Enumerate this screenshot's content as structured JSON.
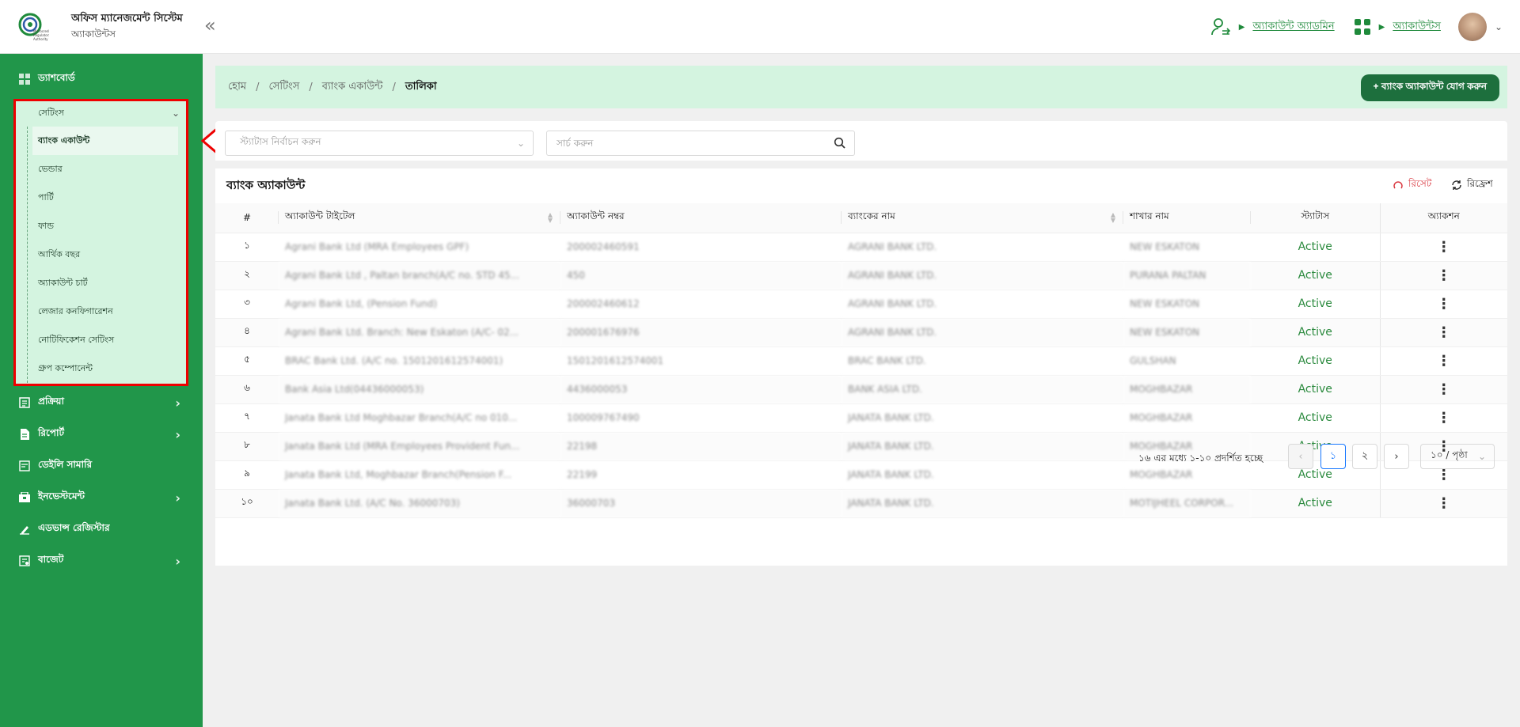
{
  "header": {
    "app_name": "অফিস ম্যানেজমেন্ট সিস্টেম",
    "app_sub": "অ্যাকাউন্টস",
    "role_link": "অ্যাকাউন্ট অ্যাডমিন",
    "module_link": "অ্যাকাউন্টস",
    "logo_text": [
      "Microcredit",
      "Regulatory",
      "Authority"
    ]
  },
  "sidebar": {
    "dashboard": "ড্যাশবোর্ড",
    "settings": "সেটিংস",
    "settings_items": [
      "ব্যাংক একাউন্ট",
      "ভেন্ডার",
      "পার্টি",
      "ফান্ড",
      "আর্থিক বছর",
      "অ্যাকাউন্ট চার্ট",
      "লেজার কনফিগারেশন",
      "নোটিফিকেশন সেটিংস",
      "গ্রুপ কম্পোনেন্ট"
    ],
    "process": "প্রক্রিয়া",
    "report": "রিপোর্ট",
    "daily_summary": "ডেইলি সামারি",
    "investment": "ইনভেস্টমেন্ট",
    "advance_register": "এডভান্স রেজিস্টার",
    "budget": "বাজেট"
  },
  "breadcrumb": [
    "হোম",
    "সেটিংস",
    "ব্যাংক একাউন্ট",
    "তালিকা"
  ],
  "add_button": "+ ব্যাংক অ্যাকাউন্ট যোগ করুন",
  "filters": {
    "status_placeholder": "স্ট্যাটাস নির্বাচন করুন",
    "search_placeholder": "সার্চ করুন"
  },
  "panel": {
    "title": "ব্যাংক অ্যাকাউন্ট",
    "reset": "রিসেট",
    "refresh": "রিফ্রেশ"
  },
  "table": {
    "headers": [
      "#",
      "অ্যাকাউন্ট টাইটেল",
      "অ্যাকাউন্ট নম্বর",
      "ব্যাংকের নাম",
      "শাখার নাম",
      "স্ট্যাটাস",
      "অ্যাকশন"
    ],
    "rows": [
      {
        "n": "১",
        "title": "Agrani Bank Ltd (MRA Employees GPF)",
        "acc": "200002460591",
        "bank": "AGRANI BANK LTD.",
        "branch": "NEW ESKATON",
        "status": "Active"
      },
      {
        "n": "২",
        "title": "Agrani Bank Ltd , Paltan branch(A/C no. STD 45...",
        "acc": "450",
        "bank": "AGRANI BANK LTD.",
        "branch": "PURANA PALTAN",
        "status": "Active"
      },
      {
        "n": "৩",
        "title": "Agrani Bank Ltd, (Pension Fund)",
        "acc": "200002460612",
        "bank": "AGRANI BANK LTD.",
        "branch": "NEW ESKATON",
        "status": "Active"
      },
      {
        "n": "৪",
        "title": "Agrani Bank Ltd. Branch: New Eskaton (A/C- 02...",
        "acc": "200001676976",
        "bank": "AGRANI BANK LTD.",
        "branch": "NEW ESKATON",
        "status": "Active"
      },
      {
        "n": "৫",
        "title": "BRAC Bank Ltd. (A/C no. 1501201612574001)",
        "acc": "1501201612574001",
        "bank": "BRAC BANK LTD.",
        "branch": "GULSHAN",
        "status": "Active"
      },
      {
        "n": "৬",
        "title": "Bank Asia Ltd(04436000053)",
        "acc": "4436000053",
        "bank": "BANK ASIA LTD.",
        "branch": "MOGHBAZAR",
        "status": "Active"
      },
      {
        "n": "৭",
        "title": "Janata Bank Ltd Moghbazar Branch(A/C no 010...",
        "acc": "100009767490",
        "bank": "JANATA BANK LTD.",
        "branch": "MOGHBAZAR",
        "status": "Active"
      },
      {
        "n": "৮",
        "title": "Janata Bank Ltd (MRA Employees Provident Fun...",
        "acc": "22198",
        "bank": "JANATA BANK LTD.",
        "branch": "MOGHBAZAR",
        "status": "Active"
      },
      {
        "n": "৯",
        "title": "Janata Bank Ltd, Moghbazar Branch(Pension F...",
        "acc": "22199",
        "bank": "JANATA BANK LTD.",
        "branch": "MOGHBAZAR",
        "status": "Active"
      },
      {
        "n": "১০",
        "title": "Janata Bank Ltd. (A/C No. 36000703)",
        "acc": "36000703",
        "bank": "JANATA BANK LTD.",
        "branch": "MOTIJHEEL CORPOR...",
        "status": "Active"
      }
    ]
  },
  "pagination": {
    "info": "১৬ এর মধ্যে ১-১০ প্রদর্শিত হচ্ছে",
    "pages": [
      "১",
      "২"
    ],
    "page_size": "১০ / পৃষ্ঠা"
  },
  "colors": {
    "sidebar": "#21964a",
    "accent": "#1d6f3d",
    "status_active": "#2b8a3e",
    "highlight": "#e00000"
  }
}
